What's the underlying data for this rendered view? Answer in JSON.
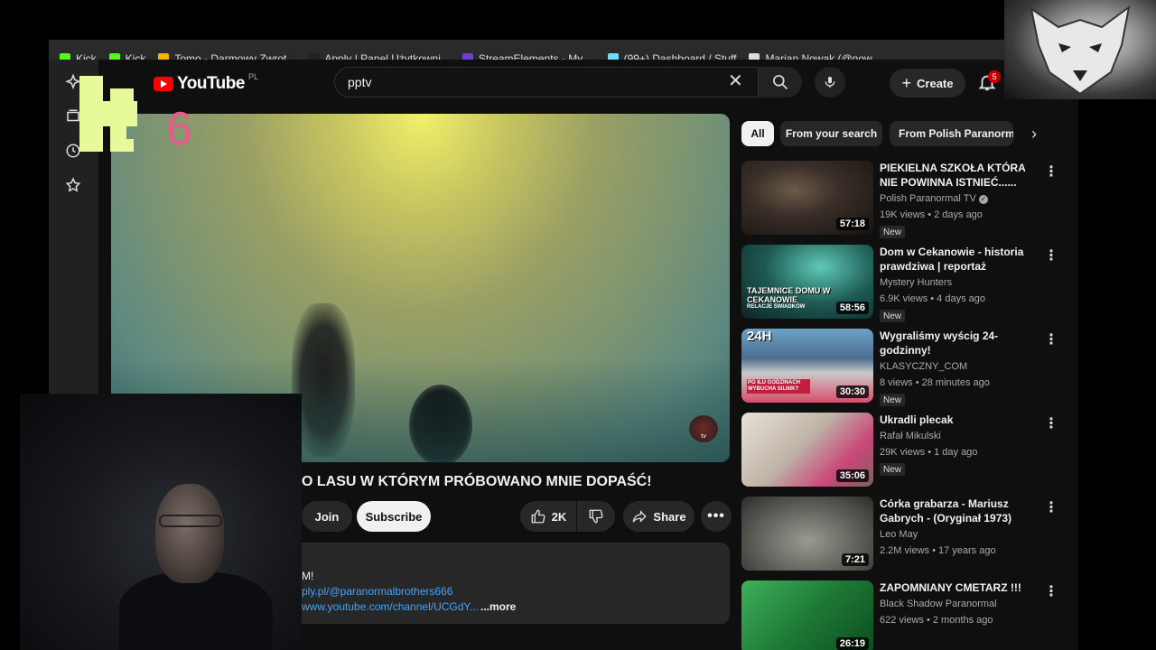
{
  "bookmarks": [
    {
      "label": "Kick",
      "color": "#53fc18"
    },
    {
      "label": "Kick",
      "color": "#53fc18"
    },
    {
      "label": "Tomo - Darmowy Zwrot...",
      "color": "#f5b400"
    },
    {
      "label": "Apply | Panel Użytkowni...",
      "color": "#222222"
    },
    {
      "label": "StreamElements - My ...",
      "color": "#6b3fd8"
    },
    {
      "label": "(99+) Dashboard / Stuff",
      "color": "#67e2ff"
    },
    {
      "label": "Marian Nowak (@now...",
      "color": "#dddddd"
    }
  ],
  "header": {
    "logo_text": "YouTube",
    "logo_region": "PL",
    "search_value": "pptv",
    "create_label": "Create",
    "notification_count": "5"
  },
  "video": {
    "title": "O LASU W KTÓRYM PRÓBOWANO MNIE DOPAŚĆ!",
    "watermark": "tv",
    "join_label": "Join",
    "subscribe_label": "Subscribe",
    "like_count": "2K",
    "share_label": "Share"
  },
  "description": {
    "line1": "M!",
    "line2": "ply.pl/@paranormalbrothers666",
    "line3": "www.youtube.com/channel/UCGdY...",
    "more_label": "...more"
  },
  "chips": [
    "All",
    "From your search",
    "From Polish Paranorma"
  ],
  "recommendations": [
    {
      "title": "PIEKIELNA SZKOŁA KTÓRA NIE POWINNA ISTNIEĆ......",
      "channel": "Polish Paranormal TV",
      "verified": true,
      "meta": "19K views • 2 days ago",
      "badge": "New",
      "duration": "57:18",
      "thumb": "dark"
    },
    {
      "title": "Dom w Cekanowie - historia prawdziwa | reportaż",
      "channel": "Mystery Hunters",
      "verified": false,
      "meta": "6.9K views • 4 days ago",
      "badge": "New",
      "duration": "58:56",
      "thumb": "teal",
      "thumb_text": "TAJEMNICE DOMU W CEKANOWIE",
      "thumb_sub": "RELACJE ŚWIADKÓW"
    },
    {
      "title": "Wygraliśmy wyścig 24-godzinny!",
      "channel": "KLASYCZNY_COM",
      "verified": false,
      "meta": "8 views • 28 minutes ago",
      "badge": "New",
      "duration": "30:30",
      "thumb": "race",
      "thumb_text": "24H",
      "thumb_sub": "PO ILU GODZINACH WYBUCHA SILNIK?"
    },
    {
      "title": "Ukradli plecak",
      "channel": "Rafał Mikulski",
      "verified": false,
      "meta": "29K views • 1 day ago",
      "badge": "New",
      "duration": "35:06",
      "thumb": "room"
    },
    {
      "title": "Córka grabarza - Mariusz Gabrych - (Oryginał 1973)",
      "channel": "Leo May",
      "verified": false,
      "meta": "2.2M views • 17 years ago",
      "badge": "",
      "duration": "7:21",
      "thumb": "bw"
    },
    {
      "title": "ZAPOMNIANY CMETARZ !!!",
      "channel": "Black Shadow Paranormal",
      "verified": false,
      "meta": "622 views • 2 months ago",
      "badge": "",
      "duration": "26:19",
      "thumb": "green"
    }
  ],
  "overlay": {
    "k6_digit": "6"
  }
}
